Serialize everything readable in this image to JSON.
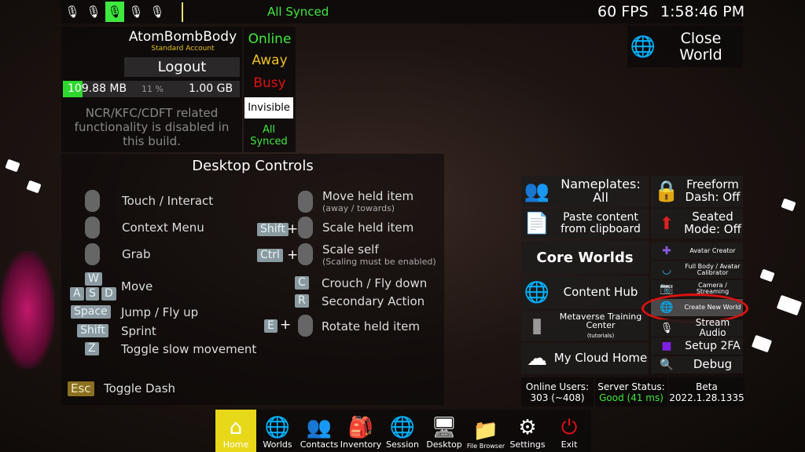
{
  "top_bar": {
    "mics": [
      "muted-mic-icon",
      "whisper-mic-icon",
      "normal-mic-icon",
      "shout-mic-icon",
      "broadcast-mic-icon"
    ],
    "active_mic": 2,
    "sync_status": "All Synced",
    "fps": "60 FPS",
    "time": "1:58:46 PM"
  },
  "user": {
    "name": "AtomBombBody",
    "account": "Standard Account",
    "logout": "Logout",
    "storage_used": "109.88 MB",
    "storage_percent_label": "11 %",
    "storage_percent": 11,
    "storage_total": "1.00 GB",
    "notice": "NCR/KFC/CDFT related functionality is disabled in this build."
  },
  "status": {
    "online": "Online",
    "away": "Away",
    "busy": "Busy",
    "invisible": "Invisible",
    "sync": "All Synced"
  },
  "close_world": "Close World",
  "controls": {
    "title": "Desktop Controls",
    "left": [
      {
        "label": "Touch / Interact"
      },
      {
        "label": "Context Menu"
      },
      {
        "label": "Grab"
      },
      {
        "keys": [
          "W",
          "A",
          "S",
          "D"
        ],
        "label": "Move"
      },
      {
        "keys": [
          "Space"
        ],
        "label": "Jump / Fly up"
      },
      {
        "keys": [
          "Shift"
        ],
        "label": "Sprint"
      },
      {
        "keys": [
          "Z"
        ],
        "label": "Toggle slow movement"
      }
    ],
    "right": [
      {
        "label": "Move held item",
        "sub": "(away / towards)"
      },
      {
        "key": "Shift",
        "label": "Scale held item"
      },
      {
        "key": "Ctrl",
        "label": "Scale self",
        "sub": "(Scaling must be enabled)"
      },
      {
        "key": "C",
        "label": "Crouch / Fly down"
      },
      {
        "key": "R",
        "label": "Secondary Action"
      },
      {
        "key": "E",
        "label": "Rotate held item"
      }
    ],
    "plus": "+",
    "esc": {
      "key": "Esc",
      "label": "Toggle Dash"
    }
  },
  "quick": {
    "nameplates": "Nameplates: All",
    "freeform": "Freeform Dash: Off",
    "paste": "Paste content from clipboard",
    "seated": "Seated Mode: Off",
    "core_worlds": "Core Worlds",
    "content_hub": "Content Hub",
    "training": "Metaverse Training Center",
    "training_sub": "(tutorials)",
    "cloud_home": "My Cloud Home",
    "tools": [
      "Avatar Creator",
      "Full Body / Avatar Calibrator",
      "Camera / Streaming",
      "Create New World",
      "Stream Audio",
      "Setup 2FA",
      "Debug"
    ]
  },
  "footer": {
    "online_users_label": "Online Users:",
    "online_users": "303 (~408)",
    "server_label": "Server Status:",
    "server_status": "Good (41 ms)",
    "build_label": "Beta",
    "build": "2022.1.28.1335"
  },
  "taskbar": [
    {
      "label": "Home",
      "icon": "home-icon",
      "active": true
    },
    {
      "label": "Worlds",
      "icon": "worlds-icon"
    },
    {
      "label": "Contacts",
      "icon": "contacts-icon"
    },
    {
      "label": "Inventory",
      "icon": "backpack-icon"
    },
    {
      "label": "Session",
      "icon": "session-icon"
    },
    {
      "label": "Desktop",
      "icon": "desktop-icon"
    },
    {
      "label": "File Browser",
      "icon": "folder-icon"
    },
    {
      "label": "Settings",
      "icon": "gear-icon"
    },
    {
      "label": "Exit",
      "icon": "power-icon"
    }
  ],
  "colors": {
    "green": "#3ee83e",
    "yellow": "#f0c020",
    "red": "#e01010",
    "accent": "#e8d81a"
  }
}
